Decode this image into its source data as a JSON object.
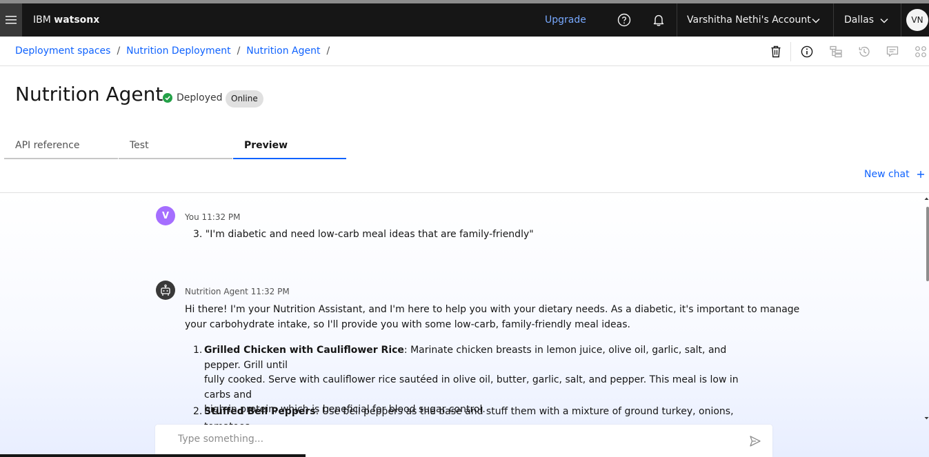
{
  "header": {
    "brand_prefix": "IBM",
    "brand_product": "watsonx",
    "upgrade_label": "Upgrade",
    "account_label": "Varshitha Nethi's Account",
    "region_label": "Dallas",
    "avatar_initials": "VN"
  },
  "breadcrumb": {
    "items": [
      "Deployment spaces",
      "Nutrition Deployment",
      "Nutrition Agent"
    ],
    "separator": "/"
  },
  "page": {
    "title": "Nutrition Agent",
    "status_label": "Deployed",
    "tag_label": "Online"
  },
  "tabs": [
    {
      "label": "API reference",
      "active": false
    },
    {
      "label": "Test",
      "active": false
    },
    {
      "label": "Preview",
      "active": true
    }
  ],
  "chat": {
    "new_chat_label": "New chat",
    "messages": [
      {
        "avatar": "V",
        "author": "You",
        "time": "11:32 PM",
        "text": "3. \"I'm diabetic and need low-carb meal ideas that are family-friendly\""
      },
      {
        "avatar": "robot-icon",
        "author": "Nutrition Agent",
        "time": "11:32 PM",
        "intro_line1": "Hi there! I'm your Nutrition Assistant, and I'm here to help you with your dietary needs. As a diabetic, it's important to manage",
        "intro_line2": "your carbohydrate intake, so I'll provide you with some low-carb, family-friendly meal ideas.",
        "items": [
          {
            "number": "1.",
            "title": "Grilled Chicken with Cauliflower Rice",
            "line1": ": Marinate chicken breasts in lemon juice, olive oil, garlic, salt, and pepper. Grill until",
            "line2": "fully cooked. Serve with cauliflower rice sautéed in olive oil, butter, garlic, salt, and pepper. This meal is low in carbs and",
            "line3": "high in protein, which is beneficial for blood sugar control."
          },
          {
            "number": "2.",
            "title": "Stuffed Bell Peppers",
            "line1": ": Use bell peppers as the base and stuff them with a mixture of ground turkey, onions, tomatoes,"
          }
        ]
      }
    ],
    "input_placeholder": "Type something..."
  },
  "colors": {
    "header_bg": "#161616",
    "link": "#0f62fe",
    "upgrade": "#78a9ff",
    "deployed": "#24a148",
    "user_avatar": "#a56eff"
  }
}
